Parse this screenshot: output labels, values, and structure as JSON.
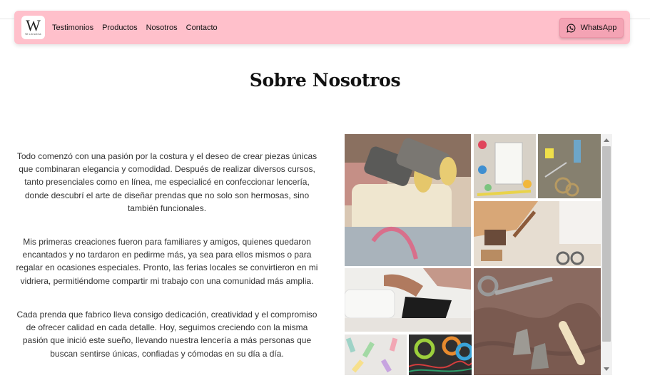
{
  "nav": {
    "logo_letter": "W",
    "logo_sub": "W Lencería",
    "links": [
      "Testimonios",
      "Productos",
      "Nosotros",
      "Contacto"
    ],
    "whatsapp_label": "WhatsApp"
  },
  "about": {
    "title": "Sobre Nosotros",
    "paragraphs": [
      "Todo comenzó con una pasión por la costura y el deseo de crear piezas únicas que combinaran elegancia y comodidad. Después de realizar diversos cursos, tanto presenciales como en línea, me especialicé en confeccionar lencería, donde descubrí el arte de diseñar prendas que no solo son hermosas, sino también funcionales.",
      "Mis primeras creaciones fueron para familiares y amigos, quienes quedaron encantados y no tardaron en pedirme más, ya sea para ellos mismos o para regalar en ocasiones especiales. Pronto, las ferias locales se convirtieron en mi vidriera, permitiéndome compartir mi trabajo con una comunidad más amplia.",
      "Cada prenda que fabrico lleva consigo dedicación, creatividad y el compromiso de ofrecer calidad en cada detalle. Hoy, seguimos creciendo con la misma pasión que inició este sueño, llevando nuestra lencería a más personas que buscan sentirse únicas, confiadas y cómodas en su día a día."
    ]
  },
  "gallery": {
    "images": [
      "sewing-machine-thread-image",
      "notebook-sewing-supplies-image",
      "thread-spools-scissors-image",
      "sewing-tools-fabric-image",
      "hands-sewing-image",
      "pastel-thread-spools-image",
      "colorful-thread-image",
      "thimbles-fabric-scissors-image"
    ]
  },
  "colors": {
    "navbar_bg": "#ffc0cb",
    "whatsapp_button": "#f4a3b4"
  }
}
